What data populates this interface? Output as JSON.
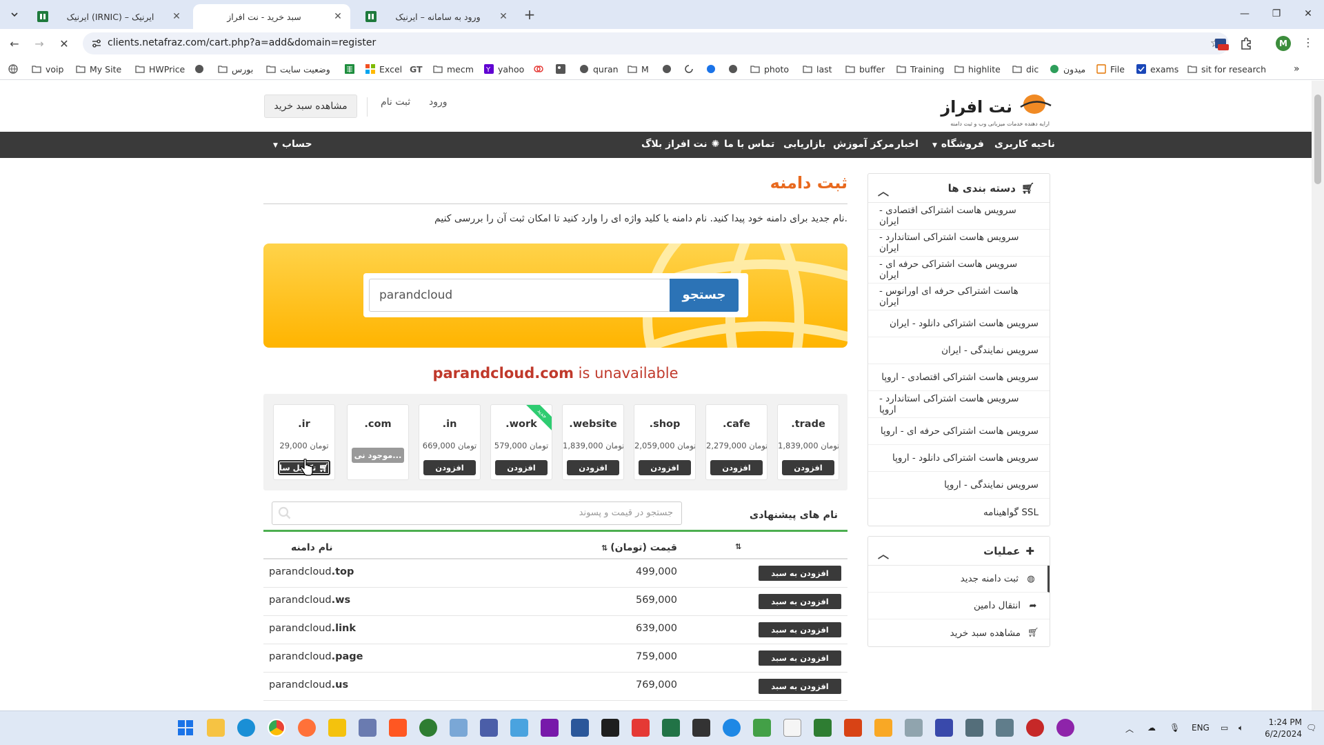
{
  "browser": {
    "tabs": [
      {
        "title": "ایرنیک (IRNIC) – ایرنیک",
        "active": false
      },
      {
        "title": "سبد خرید - نت افراز",
        "active": true
      },
      {
        "title": "ورود به سامانه – ایرنیک",
        "active": false
      }
    ],
    "url": "clients.netafraz.com/cart.php?a=add&domain=register",
    "bookmarks": [
      "voip",
      "My Site",
      "HWPrice",
      "بورس",
      "وضعیت سایت",
      "Excel",
      "mecm",
      "yahoo",
      "quran",
      "M",
      "photo",
      "last",
      "buffer",
      "Training",
      "highlite",
      "dic",
      "میدون",
      "File",
      "exams",
      "sit for research"
    ],
    "ext_badge": "106",
    "profile_initial": "M"
  },
  "site": {
    "logo_text": "نت افراز",
    "logo_tagline": "ارایه دهنده خدمات میزبانی وب و ثبت دامنه",
    "top_links": {
      "login": "ورود",
      "register": "ثبت نام",
      "view_cart": "مشاهده سبد خرید"
    },
    "nav": {
      "client_area": "ناحیه کاربری",
      "store": "فروشگاه",
      "news": "اخبار",
      "education": "مرکز آموزش",
      "marketing": "بازاریابی",
      "contact": "تماس با ما",
      "blog": "نت افراز بلاگ",
      "account": "حساب"
    }
  },
  "sidebar": {
    "categories_title": "دسته بندی ها",
    "categories": [
      "سرویس هاست اشتراکی اقتصادی - ایران",
      "سرویس هاست اشتراکی استاندارد - ایران",
      "سرویس هاست اشتراکی حرفه ای - ایران",
      "هاست اشتراکی حرفه ای اورانوس - ایران",
      "سرویس هاست اشتراکی دانلود - ایران",
      "سرویس نمایندگی - ایران",
      "سرویس هاست اشتراکی اقتصادی - اروپا",
      "سرویس هاست اشتراکی استاندارد - اروپا",
      "سرویس هاست اشتراکی حرفه ای - اروپا",
      "سرویس هاست اشتراکی دانلود - اروپا",
      "سرویس نمایندگی - اروپا",
      "گواهینامه SSL"
    ],
    "actions_title": "عملیات",
    "actions": [
      {
        "label": "ثبت دامنه جدید",
        "icon": "globe-icon",
        "active": true
      },
      {
        "label": "انتقال دامین",
        "icon": "share-arrow-icon",
        "active": false
      },
      {
        "label": "مشاهده سبد خرید",
        "icon": "cart-icon",
        "active": false
      }
    ]
  },
  "main": {
    "title": "ثبت دامنه",
    "description": "نام جدید برای دامنه خود پیدا کنید. نام دامنه یا کلید واژه ای را وارد کنید تا امکان ثبت آن را بررسی کنیم.",
    "search_value": "parandcloud",
    "search_button": "جستجو",
    "result_domain": "parandcloud.com",
    "result_status": "is unavailable",
    "tlds": [
      {
        "name": ".trade",
        "price": "1,839,000 تومان",
        "button": "افزودن",
        "state": "normal"
      },
      {
        "name": ".cafe",
        "price": "2,279,000 تومان",
        "button": "افزودن",
        "state": "normal"
      },
      {
        "name": ".shop",
        "price": "2,059,000 تومان",
        "button": "افزودن",
        "state": "normal"
      },
      {
        "name": ".website",
        "price": "1,839,000 تومان",
        "button": "افزودن",
        "state": "normal"
      },
      {
        "name": ".work",
        "price": "579,000 تومان",
        "button": "افزودن",
        "state": "normal",
        "ribbon": "جدید"
      },
      {
        "name": ".in",
        "price": "669,000 تومان",
        "button": "افزودن",
        "state": "normal"
      },
      {
        "name": ".com",
        "price": "",
        "button": "موجود نی...",
        "state": "unavailable"
      },
      {
        "name": ".ir",
        "price": "29,000 تومان",
        "button": "تکمیل سا",
        "state": "in-cart"
      }
    ],
    "suggestions_label": "نام های پیشنهادی",
    "filter_placeholder": "جستجو در قیمت و پسوند",
    "table_headers": {
      "domain": "نام دامنه",
      "price": "قیمت (تومان)"
    },
    "suggestions": [
      {
        "sld": "parandcloud",
        "tld": ".top",
        "price": "499,000",
        "button": "افزودن به سبد"
      },
      {
        "sld": "parandcloud",
        "tld": ".ws",
        "price": "569,000",
        "button": "افزودن به سبد"
      },
      {
        "sld": "parandcloud",
        "tld": ".link",
        "price": "639,000",
        "button": "افزودن به سبد"
      },
      {
        "sld": "parandcloud",
        "tld": ".page",
        "price": "759,000",
        "button": "افزودن به سبد"
      },
      {
        "sld": "parandcloud",
        "tld": ".us",
        "price": "769,000",
        "button": "افزودن به سبد"
      }
    ]
  },
  "taskbar": {
    "lang": "ENG",
    "time": "1:24 PM",
    "date": "6/2/2024"
  },
  "colors": {
    "accent_orange": "#e8691e",
    "unavailable_red": "#c0392b",
    "search_blue": "#2c73b6",
    "navbar_dark": "#3a3a3a",
    "banner_yellow": "#ffb400",
    "suggest_green": "#4caf50"
  }
}
